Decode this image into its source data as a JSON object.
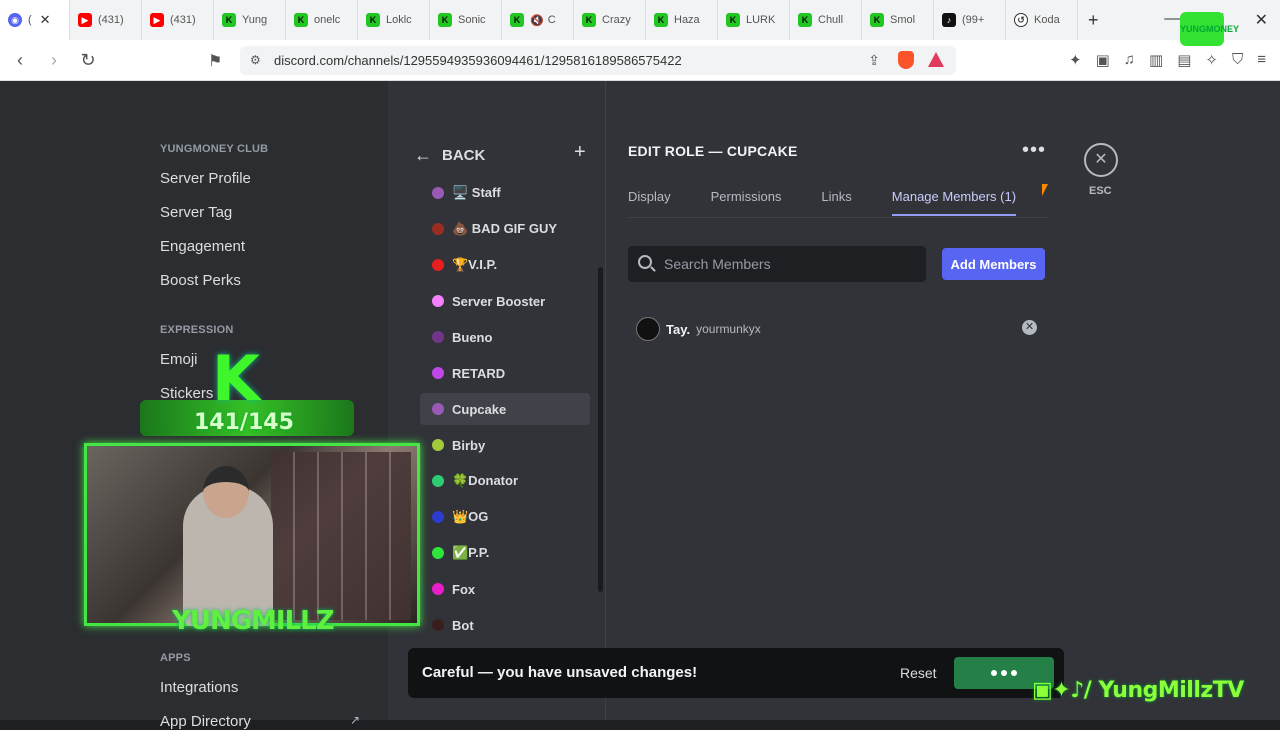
{
  "browser": {
    "tabs": [
      {
        "label": "(",
        "icon": "discord-icon",
        "active": true
      },
      {
        "label": "(431)",
        "icon": "youtube-icon"
      },
      {
        "label": "(431)",
        "icon": "youtube-icon"
      },
      {
        "label": "Yung",
        "icon": "kick-icon"
      },
      {
        "label": "onelc",
        "icon": "kick-icon"
      },
      {
        "label": "Loklc",
        "icon": "kick-icon"
      },
      {
        "label": "Sonic",
        "icon": "kick-icon"
      },
      {
        "label": "C",
        "icon": "kick-icon"
      },
      {
        "label": "Crazy",
        "icon": "kick-icon"
      },
      {
        "label": "Haza",
        "icon": "kick-icon"
      },
      {
        "label": "LURK",
        "icon": "kick-icon"
      },
      {
        "label": "Chull",
        "icon": "kick-icon"
      },
      {
        "label": "Smol",
        "icon": "kick-icon"
      },
      {
        "label": "(99+",
        "icon": "tiktok-icon"
      },
      {
        "label": "Koda",
        "icon": "koda-icon"
      }
    ],
    "url": "discord.com/channels/1295594935936094461/1295816189586575422"
  },
  "sidebar": {
    "server_heading": "YUNGMONEY CLUB",
    "server_items": [
      "Server Profile",
      "Server Tag",
      "Engagement",
      "Boost Perks"
    ],
    "expression_heading": "EXPRESSION",
    "expression_items": [
      "Emoji",
      "Stickers"
    ],
    "apps_heading": "APPS",
    "apps_items": [
      "Integrations",
      "App Directory"
    ]
  },
  "roles_panel": {
    "back_label": "BACK",
    "roles": [
      {
        "name": "🖥️ Staff",
        "color": "#9b59b6"
      },
      {
        "name": "💩 BAD GIF GUY",
        "color": "#992d22"
      },
      {
        "name": "🏆V.I.P.",
        "color": "#e91e1e"
      },
      {
        "name": "Server Booster",
        "color": "#f47fff"
      },
      {
        "name": "Bueno",
        "color": "#71368a"
      },
      {
        "name": "RETARD",
        "color": "#c048e8"
      },
      {
        "name": "Cupcake",
        "color": "#9b59b6",
        "selected": true
      },
      {
        "name": "Birby",
        "color": "#a3c93a"
      },
      {
        "name": "🍀Donator",
        "color": "#2ecc71"
      },
      {
        "name": "👑OG",
        "color": "#2d3ccf"
      },
      {
        "name": "✅P.P.",
        "color": "#2ee63a"
      },
      {
        "name": "Fox",
        "color": "#e91ecb"
      },
      {
        "name": "Bot",
        "color": "#3a1e1e"
      }
    ]
  },
  "editor": {
    "title": "EDIT ROLE — CUPCAKE",
    "tabs": [
      "Display",
      "Permissions",
      "Links",
      "Manage Members (1)"
    ],
    "search_placeholder": "Search Members",
    "add_button": "Add Members",
    "members": [
      {
        "display": "Tay.",
        "username": "yourmunkyx"
      }
    ],
    "esc_label": "ESC"
  },
  "unsaved": {
    "message": "Careful — you have unsaved changes!",
    "reset": "Reset"
  },
  "overlay": {
    "sub_letter": "K",
    "sub_count": "141/145",
    "streamer_name": "YUNGMILLZ",
    "social_handle": "/ YungMillzTV",
    "corner_logo": "YUNGMONEY"
  },
  "colors": {
    "blurple": "#5865f2",
    "save_green": "#248046",
    "overlay_green": "#43e643"
  }
}
